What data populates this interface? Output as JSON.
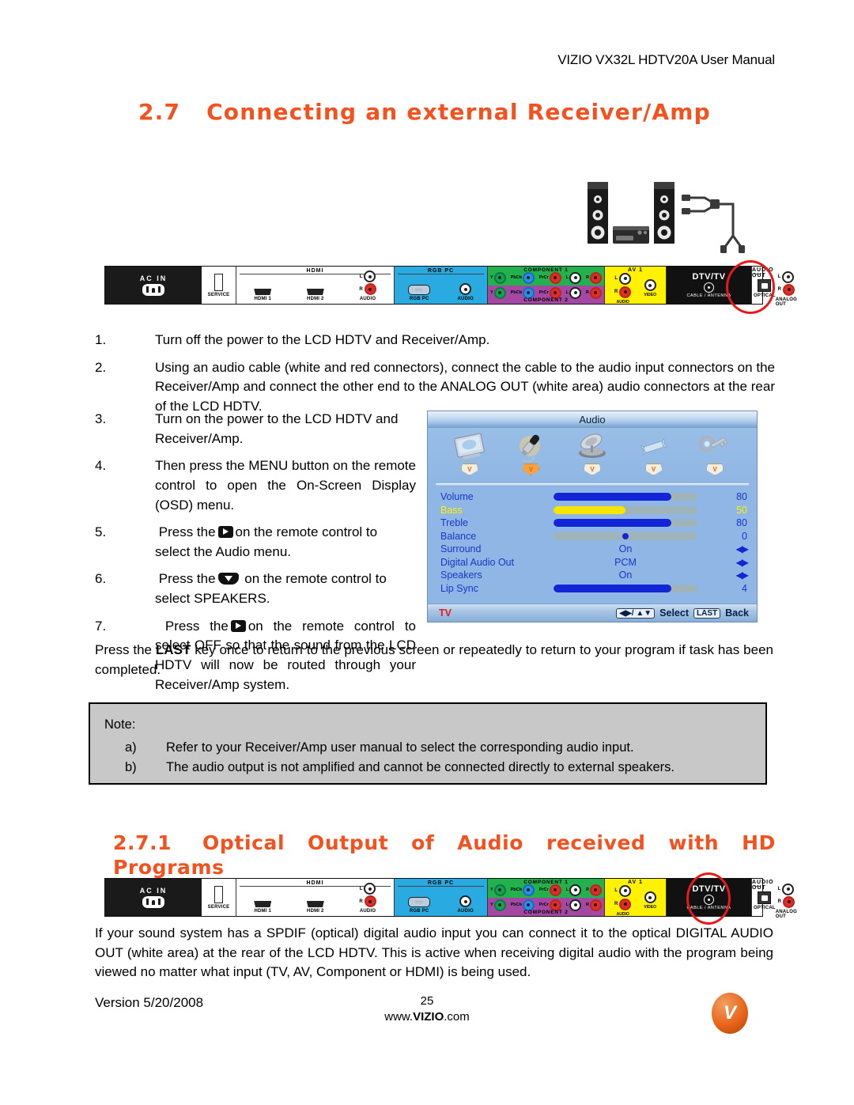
{
  "header": {
    "running_head": "VIZIO VX32L HDTV20A User Manual"
  },
  "section": {
    "number": "2.7",
    "title": "Connecting an external Receiver/Amp"
  },
  "subsection": {
    "number": "2.7.1",
    "title_line1_words": [
      "Optical",
      "Output",
      "of",
      "Audio",
      "received",
      "with",
      "HD"
    ],
    "title_line2": "Programs",
    "title_full": "2.7.1 Optical Output of Audio received with HD Programs"
  },
  "steps": [
    {
      "n": "1.",
      "text": "Turn off the power to the LCD HDTV and Receiver/Amp."
    },
    {
      "n": "2.",
      "text": "Using an audio cable (white and red connectors), connect the cable to the audio input connectors on the Receiver/Amp and connect the other end to the ANALOG OUT (white area) audio connectors at the rear of the LCD HDTV."
    },
    {
      "n": "3.",
      "text": "Turn on the power to the LCD HDTV and Receiver/Amp."
    },
    {
      "n": "4.",
      "text": "Then press the MENU button on the remote control to open the On-Screen Display (OSD) menu."
    },
    {
      "n": "5.",
      "text_before": "Press the",
      "icon": "right-arrow-button-icon",
      "text_after": "on the remote control to select the Audio menu."
    },
    {
      "n": "6.",
      "text_before": "Press the",
      "icon": "down-arrow-button-icon",
      "text_after": "on the remote control to select SPEAKERS."
    },
    {
      "n": "7.",
      "text_before": "Press the",
      "icon": "right-arrow-button-icon",
      "text_after": "on the remote control to select OFF so that the sound from the LCD HDTV will now be routed through your Receiver/Amp system."
    }
  ],
  "last_paragraph": {
    "before": "Press the ",
    "bold": "LAST",
    "after": " key once to return to the previous screen or repeatedly to return to your program if task has been completed."
  },
  "note": {
    "title": "Note:",
    "items": [
      {
        "marker": "a)",
        "text": "Refer to your Receiver/Amp user manual to select the corresponding audio input."
      },
      {
        "marker": "b)",
        "text": "The audio output is not amplified and cannot be connected directly to external speakers."
      }
    ]
  },
  "tail_paragraph": "If your sound system has a SPDIF (optical) digital audio input you can connect it to the optical DIGITAL AUDIO OUT (white area) at the rear of the LCD HDTV.  This is active when receiving digital audio with the program being viewed no matter what input (TV, AV, Component or HDMI) is being used.",
  "panel": {
    "ac_in": "AC  IN",
    "service": "SERVICE",
    "hdmi_group": "HDMI",
    "hdmi1": "HDMI 1",
    "hdmi2": "HDMI 2",
    "hdmi_audio": "AUDIO",
    "hdmi_l": "L",
    "hdmi_r": "R",
    "rgb_group": "RGB  PC",
    "rgb_port": "RGB PC",
    "rgb_audio": "AUDIO",
    "component1": "COMPONENT  1",
    "component2": "COMPONENT  2",
    "comp_y": "Y",
    "comp_pb": "PbCb",
    "comp_pr": "PrCr",
    "comp_audio": "AUDIO",
    "comp_l": "L",
    "comp_r": "R",
    "av1": "AV 1",
    "av_l": "L",
    "av_r": "R",
    "av_video": "VIDEO",
    "av_audio": "AUDIO",
    "dtv_tv": "DTV/TV",
    "dtv_sub": "CABLE / ANTENNA",
    "audio_out_group": "AUDIO OUT",
    "optical": "OPTICAL",
    "analog_out": "ANALOG  OUT",
    "analog_l": "L",
    "analog_r": "R"
  },
  "osd": {
    "title": "Audio",
    "icon_tabs": [
      {
        "name": "picture-tv-icon",
        "badge": "V",
        "selected": false
      },
      {
        "name": "audio-microphone-icon",
        "badge": "V",
        "selected": true
      },
      {
        "name": "tuner-satellite-icon",
        "badge": "V",
        "selected": false
      },
      {
        "name": "setup-wrench-icon",
        "badge": "V",
        "selected": false
      },
      {
        "name": "parental-key-icon",
        "badge": "V",
        "selected": false
      }
    ],
    "rows": [
      {
        "label": "Volume",
        "type": "bar",
        "percent": 82,
        "value": "80",
        "selected": false
      },
      {
        "label": "Bass",
        "type": "bar",
        "percent": 50,
        "value": "50",
        "selected": true
      },
      {
        "label": "Treble",
        "type": "bar",
        "percent": 82,
        "value": "80",
        "selected": false
      },
      {
        "label": "Balance",
        "type": "knob",
        "percent": 50,
        "value": "0",
        "selected": false
      },
      {
        "label": "Surround",
        "type": "option",
        "option": "On",
        "value": "arrows",
        "selected": false
      },
      {
        "label": "Digital Audio Out",
        "type": "option",
        "option": "PCM",
        "value": "arrows",
        "selected": false
      },
      {
        "label": "Speakers",
        "type": "option",
        "option": "On",
        "value": "arrows",
        "selected": false
      },
      {
        "label": "Lip Sync",
        "type": "bar",
        "percent": 82,
        "value": "4",
        "selected": false
      }
    ],
    "footer": {
      "source": "TV",
      "nav_keys": "◀▶/ ▲▼",
      "select": "Select",
      "last_key": "LAST",
      "back": "Back"
    }
  },
  "footer": {
    "version": "Version 5/20/2008",
    "page_number": "25",
    "site_prefix": "www.",
    "site_brand": "VIZIO",
    "site_suffix": ".com",
    "logo_letter": "V"
  },
  "colors": {
    "heading_orange": "#F4511E",
    "highlight_red": "#E8191A",
    "note_bg": "#C8C8C8",
    "osd_blue": "#8FB6E4",
    "osd_text": "#1A36C8",
    "osd_selected": "#FFF000",
    "bar_fill": "#1226D8",
    "bar_fill_selected": "#F6E500"
  }
}
